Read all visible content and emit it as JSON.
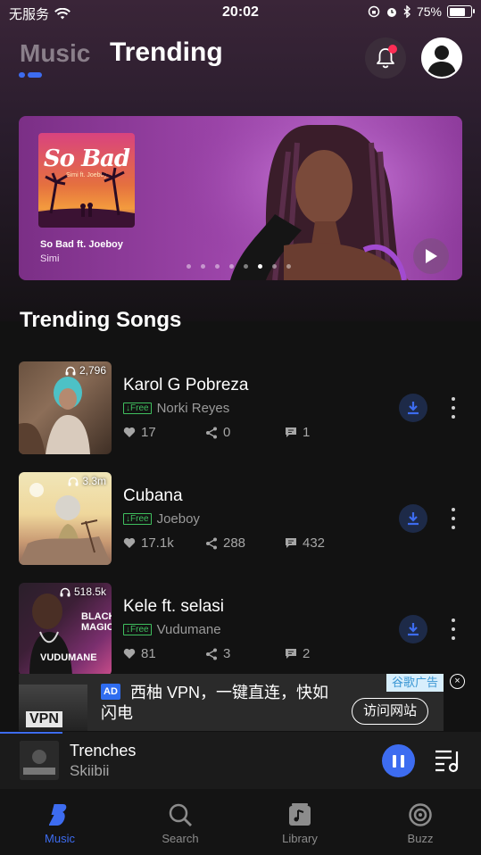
{
  "status_bar": {
    "carrier": "无服务",
    "time": "20:02",
    "battery_percent": "75%"
  },
  "header": {
    "tab_music": "Music",
    "tab_trending": "Trending"
  },
  "banner": {
    "cover_title": "So Bad",
    "cover_subtitle": "Simi ft. Joeboy",
    "song": "So Bad ft. Joeboy",
    "artist": "Simi",
    "page_count": 8,
    "active_page": 6
  },
  "section_title": "Trending Songs",
  "songs": [
    {
      "title": "Karol G Pobreza",
      "free_label": "↓Free",
      "artist": "Norki Reyes",
      "listens": "2,796",
      "likes": "17",
      "shares": "0",
      "comments": "1"
    },
    {
      "title": "Cubana",
      "free_label": "↓Free",
      "artist": "Joeboy",
      "listens": "3.3m",
      "likes": "17.1k",
      "shares": "288",
      "comments": "432"
    },
    {
      "title": "Kele ft. selasi",
      "free_label": "↓Free",
      "artist": "Vudumane",
      "listens": "518.5k",
      "likes": "81",
      "shares": "3",
      "comments": "2",
      "thumb_text_1": "BLACK",
      "thumb_text_2": "MAGIC",
      "thumb_text_3": "VUDUMANE"
    }
  ],
  "ad": {
    "badge": "AD",
    "text": "西柚 VPN，一键直连，快如闪电",
    "cta": "访问网站",
    "label": "谷歌广告",
    "close": "×",
    "thumb_text": "VPN"
  },
  "player": {
    "title": "Trenches",
    "artist": "Skiibii",
    "progress": 0.13
  },
  "tabbar": {
    "items": [
      {
        "label": "Music",
        "icon": "music-logo-icon",
        "active": true
      },
      {
        "label": "Search",
        "icon": "search-icon",
        "active": false
      },
      {
        "label": "Library",
        "icon": "library-icon",
        "active": false
      },
      {
        "label": "Buzz",
        "icon": "buzz-icon",
        "active": false
      }
    ]
  },
  "colors": {
    "accent": "#3d6cf0",
    "free_green": "#3fbf5e",
    "notification_red": "#ff2d55"
  }
}
